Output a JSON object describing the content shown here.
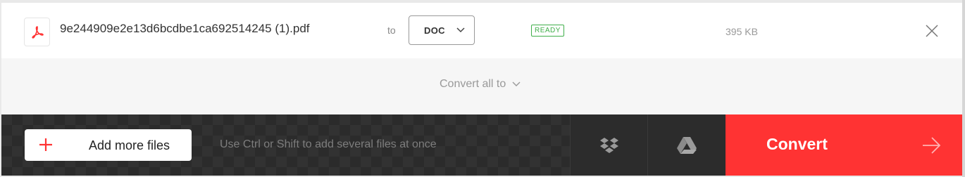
{
  "file": {
    "icon": "pdf-icon",
    "name": "9e244909e2e13d6bcdbe1ca692514245 (1).pdf",
    "to_label": "to",
    "format": "DOC",
    "status": "READY",
    "size": "395 KB"
  },
  "convert_all": {
    "label": "Convert all to"
  },
  "toolbar": {
    "add_files_label": "Add more files",
    "hint": "Use Ctrl or Shift to add several files at once",
    "convert_label": "Convert"
  },
  "colors": {
    "accent": "#ff3333",
    "ready": "#3fae49",
    "bar_dark": "#323232"
  }
}
